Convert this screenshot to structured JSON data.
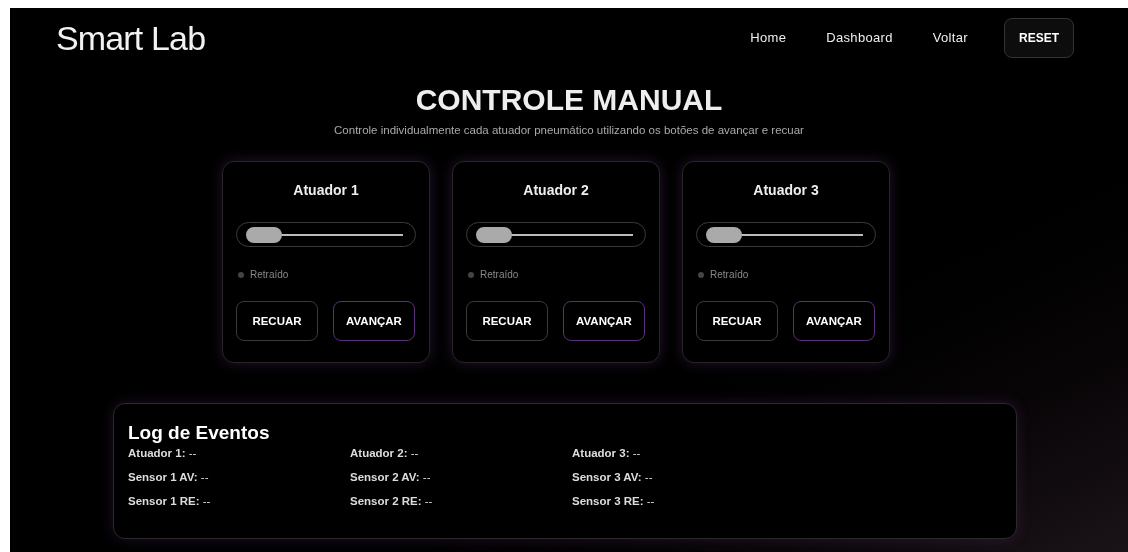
{
  "header": {
    "logo": "Smart Lab",
    "nav": [
      "Home",
      "Dashboard",
      "Voltar"
    ],
    "reset_button": "RESET"
  },
  "title": "CONTROLE MANUAL",
  "subtitle": "Controle individualmente cada atuador pneumático utilizando os botões de avançar e recuar",
  "actuators": [
    {
      "name": "Atuador 1",
      "extended": false,
      "status": "Retraído",
      "buttons": [
        "RECUAR",
        "AVANÇAR"
      ]
    },
    {
      "name": "Atuador 2",
      "extended": false,
      "status": "Retraído",
      "buttons": [
        "RECUAR",
        "AVANÇAR"
      ]
    },
    {
      "name": "Atuador 3",
      "extended": false,
      "status": "Retraído",
      "buttons": [
        "RECUAR",
        "AVANÇAR"
      ]
    }
  ],
  "log": {
    "title": "Log de Eventos",
    "columns": [
      [
        "**Atuador 1:** --",
        "**Sensor 1 AV:** --",
        "**Sensor 1 RE:** --"
      ],
      [
        "**Atuador 2:** --",
        "**Sensor 2 AV:** --",
        "**Sensor 2 RE:** --"
      ],
      [
        "**Atuador 3:** --",
        "**Sensor 3 AV:** --",
        "**Sensor 3 RE:** --"
      ]
    ]
  }
}
